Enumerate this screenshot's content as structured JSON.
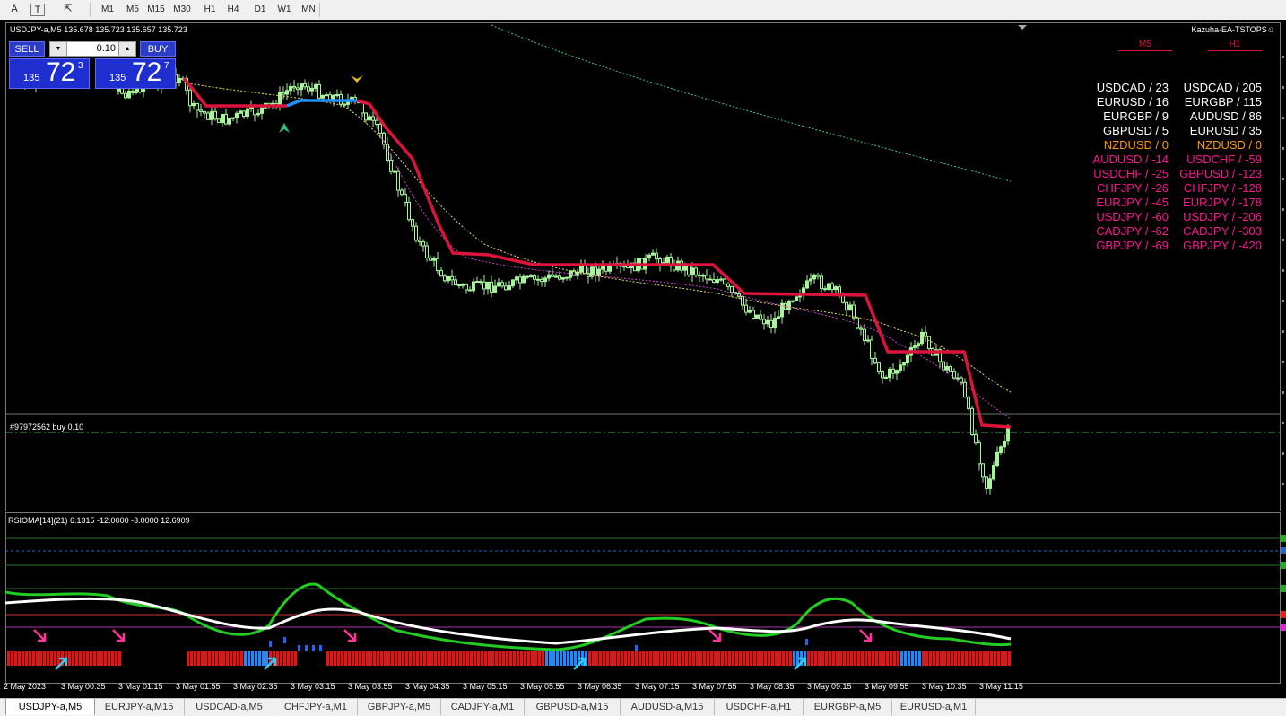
{
  "toolbar": {
    "text_tool": "A",
    "text_label_tool": "T",
    "shapes_tool": "⇱",
    "timeframes": [
      "M1",
      "M5",
      "M15",
      "M30",
      "H1",
      "H4",
      "D1",
      "W1",
      "MN"
    ]
  },
  "chart": {
    "symbol_info": "USDJPY-a,M5  135.678 135.723 135.657 135.723",
    "ea_name": "Kazuha-EA-TSTOPS☺",
    "order_label": "#97972562 buy 0.10",
    "indicator_label": "RSIOMA[14](21) 6.1315 -12.0000 -3.0000 12.6909",
    "colors": {
      "background": "#000000",
      "bull_candle": "#a6f59a",
      "trail_red": "#dc143c",
      "trail_blue": "#1e90ff",
      "rsioma_green": "#22cc22",
      "rsioma_white": "#ffffff"
    }
  },
  "one_click": {
    "sell_label": "SELL",
    "buy_label": "BUY",
    "lot": "0.10",
    "dec_icon": "▼",
    "inc_icon": "▲",
    "sell_price_small": "135",
    "sell_price_big": "72",
    "sell_price_sup": "3",
    "buy_price_small": "135",
    "buy_price_big": "72",
    "buy_price_sup": "7"
  },
  "strength": {
    "m5_header": "M5",
    "h1_header": "H1",
    "m5": [
      {
        "text": "USDCAD / 23",
        "color": "#ffffff"
      },
      {
        "text": "EURUSD / 16",
        "color": "#ffffff"
      },
      {
        "text": "EURGBP / 9",
        "color": "#ffffff"
      },
      {
        "text": "GBPUSD / 5",
        "color": "#ffffff"
      },
      {
        "text": "NZDUSD / 0",
        "color": "#ff9900"
      },
      {
        "text": "AUDUSD / -14",
        "color": "#ff1493"
      },
      {
        "text": "USDCHF / -25",
        "color": "#ff1493"
      },
      {
        "text": "CHFJPY / -26",
        "color": "#ff1493"
      },
      {
        "text": "EURJPY / -45",
        "color": "#ff1493"
      },
      {
        "text": "USDJPY / -60",
        "color": "#ff1493"
      },
      {
        "text": "CADJPY / -62",
        "color": "#ff1493"
      },
      {
        "text": "GBPJPY / -69",
        "color": "#ff1493"
      }
    ],
    "h1": [
      {
        "text": "USDCAD / 205",
        "color": "#ffffff"
      },
      {
        "text": "EURGBP / 115",
        "color": "#ffffff"
      },
      {
        "text": "AUDUSD / 86",
        "color": "#ffffff"
      },
      {
        "text": "EURUSD / 35",
        "color": "#ffffff"
      },
      {
        "text": "NZDUSD / 0",
        "color": "#ff9900"
      },
      {
        "text": "USDCHF / -59",
        "color": "#ff1493"
      },
      {
        "text": "GBPUSD / -123",
        "color": "#ff1493"
      },
      {
        "text": "CHFJPY / -128",
        "color": "#ff1493"
      },
      {
        "text": "EURJPY / -178",
        "color": "#ff1493"
      },
      {
        "text": "USDJPY / -206",
        "color": "#ff1493"
      },
      {
        "text": "CADJPY / -303",
        "color": "#ff1493"
      },
      {
        "text": "GBPJPY / -420",
        "color": "#ff1493"
      }
    ]
  },
  "date_axis": [
    "2 May 2023",
    "3 May 00:35",
    "3 May 01:15",
    "3 May 01:55",
    "3 May 02:35",
    "3 May 03:15",
    "3 May 03:55",
    "3 May 04:35",
    "3 May 05:15",
    "3 May 05:55",
    "3 May 06:35",
    "3 May 07:15",
    "3 May 07:55",
    "3 May 08:35",
    "3 May 09:15",
    "3 May 09:55",
    "3 May 10:35",
    "3 May 11:15"
  ],
  "tabs": [
    {
      "label": "USDJPY-a,M5",
      "active": true
    },
    {
      "label": "EURJPY-a,M15",
      "active": false
    },
    {
      "label": "USDCAD-a,M5",
      "active": false
    },
    {
      "label": "CHFJPY-a,M1",
      "active": false
    },
    {
      "label": "GBPJPY-a,M5",
      "active": false
    },
    {
      "label": "CADJPY-a,M1",
      "active": false
    },
    {
      "label": "GBPUSD-a,M15",
      "active": false
    },
    {
      "label": "AUDUSD-a,M15",
      "active": false
    },
    {
      "label": "USDCHF-a,H1",
      "active": false
    },
    {
      "label": "EURGBP-a,M5",
      "active": false
    },
    {
      "label": "EURUSD-a,M1",
      "active": false
    }
  ]
}
